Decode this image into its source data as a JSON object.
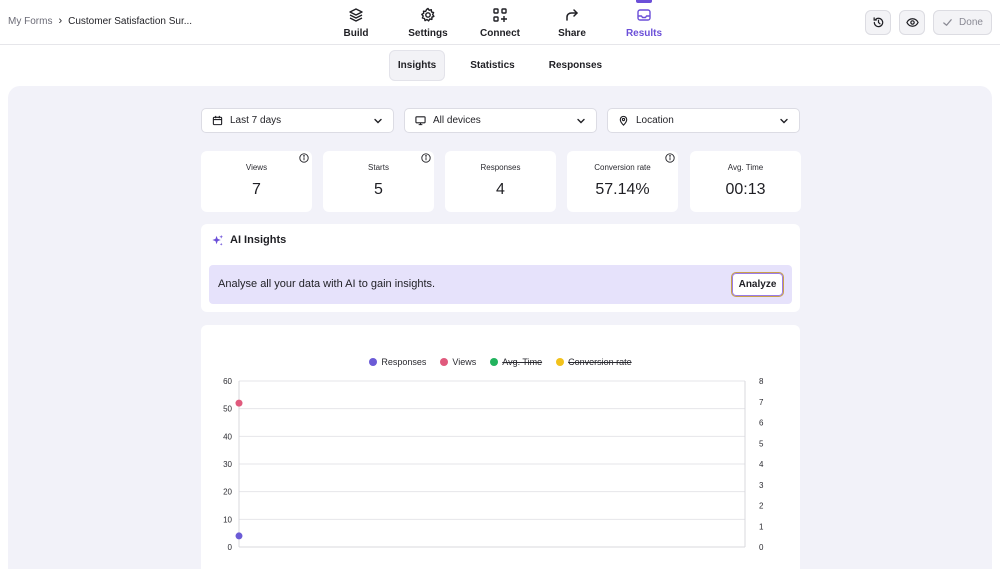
{
  "breadcrumb": {
    "root": "My Forms",
    "separator": "›",
    "current": "Customer Satisfaction Sur..."
  },
  "nav": {
    "items": [
      {
        "label": "Build",
        "icon": "layers-icon"
      },
      {
        "label": "Settings",
        "icon": "gear-icon"
      },
      {
        "label": "Connect",
        "icon": "connect-icon"
      },
      {
        "label": "Share",
        "icon": "share-icon"
      },
      {
        "label": "Results",
        "icon": "inbox-icon"
      }
    ],
    "active": "Results"
  },
  "actions": {
    "history_icon": "history-icon",
    "preview_icon": "eye-icon",
    "done_label": "Done"
  },
  "subtabs": {
    "items": [
      "Insights",
      "Statistics",
      "Responses"
    ],
    "active": "Insights"
  },
  "filters": {
    "date": "Last 7 days",
    "devices": "All devices",
    "location": "Location"
  },
  "stats": [
    {
      "label": "Views",
      "value": "7",
      "info": true
    },
    {
      "label": "Starts",
      "value": "5",
      "info": true
    },
    {
      "label": "Responses",
      "value": "4",
      "info": false
    },
    {
      "label": "Conversion rate",
      "value": "57.14%",
      "info": true
    },
    {
      "label": "Avg. Time",
      "value": "00:13",
      "info": false
    }
  ],
  "ai": {
    "title": "AI Insights",
    "banner_text": "Analyse all your data with AI to gain insights.",
    "analyze_label": "Analyze"
  },
  "colors": {
    "accent": "#6b4fd8",
    "responses": "#6b5bd6",
    "views": "#e05a7d",
    "avg_time": "#22b35e",
    "conversion_rate": "#f2c21b"
  },
  "chart_data": {
    "type": "scatter",
    "title": "",
    "legend_placement": "top",
    "series": [
      {
        "name": "Responses",
        "color": "#6b5bd6",
        "axis": "left",
        "visible": true,
        "points": [
          [
            0,
            4
          ]
        ]
      },
      {
        "name": "Views",
        "color": "#e05a7d",
        "axis": "left",
        "visible": true,
        "points": [
          [
            0,
            52
          ]
        ]
      },
      {
        "name": "Avg. Time",
        "color": "#22b35e",
        "axis": "right",
        "visible": false,
        "points": []
      },
      {
        "name": "Conversion rate",
        "color": "#f2c21b",
        "axis": "right",
        "visible": false,
        "points": []
      }
    ],
    "y_left": {
      "min": 0,
      "max": 60,
      "ticks": [
        0,
        10,
        20,
        30,
        40,
        50,
        60
      ]
    },
    "y_right": {
      "min": 0,
      "max": 8,
      "ticks": [
        0,
        1,
        2,
        3,
        4,
        5,
        6,
        7,
        8
      ]
    },
    "grid": true
  }
}
